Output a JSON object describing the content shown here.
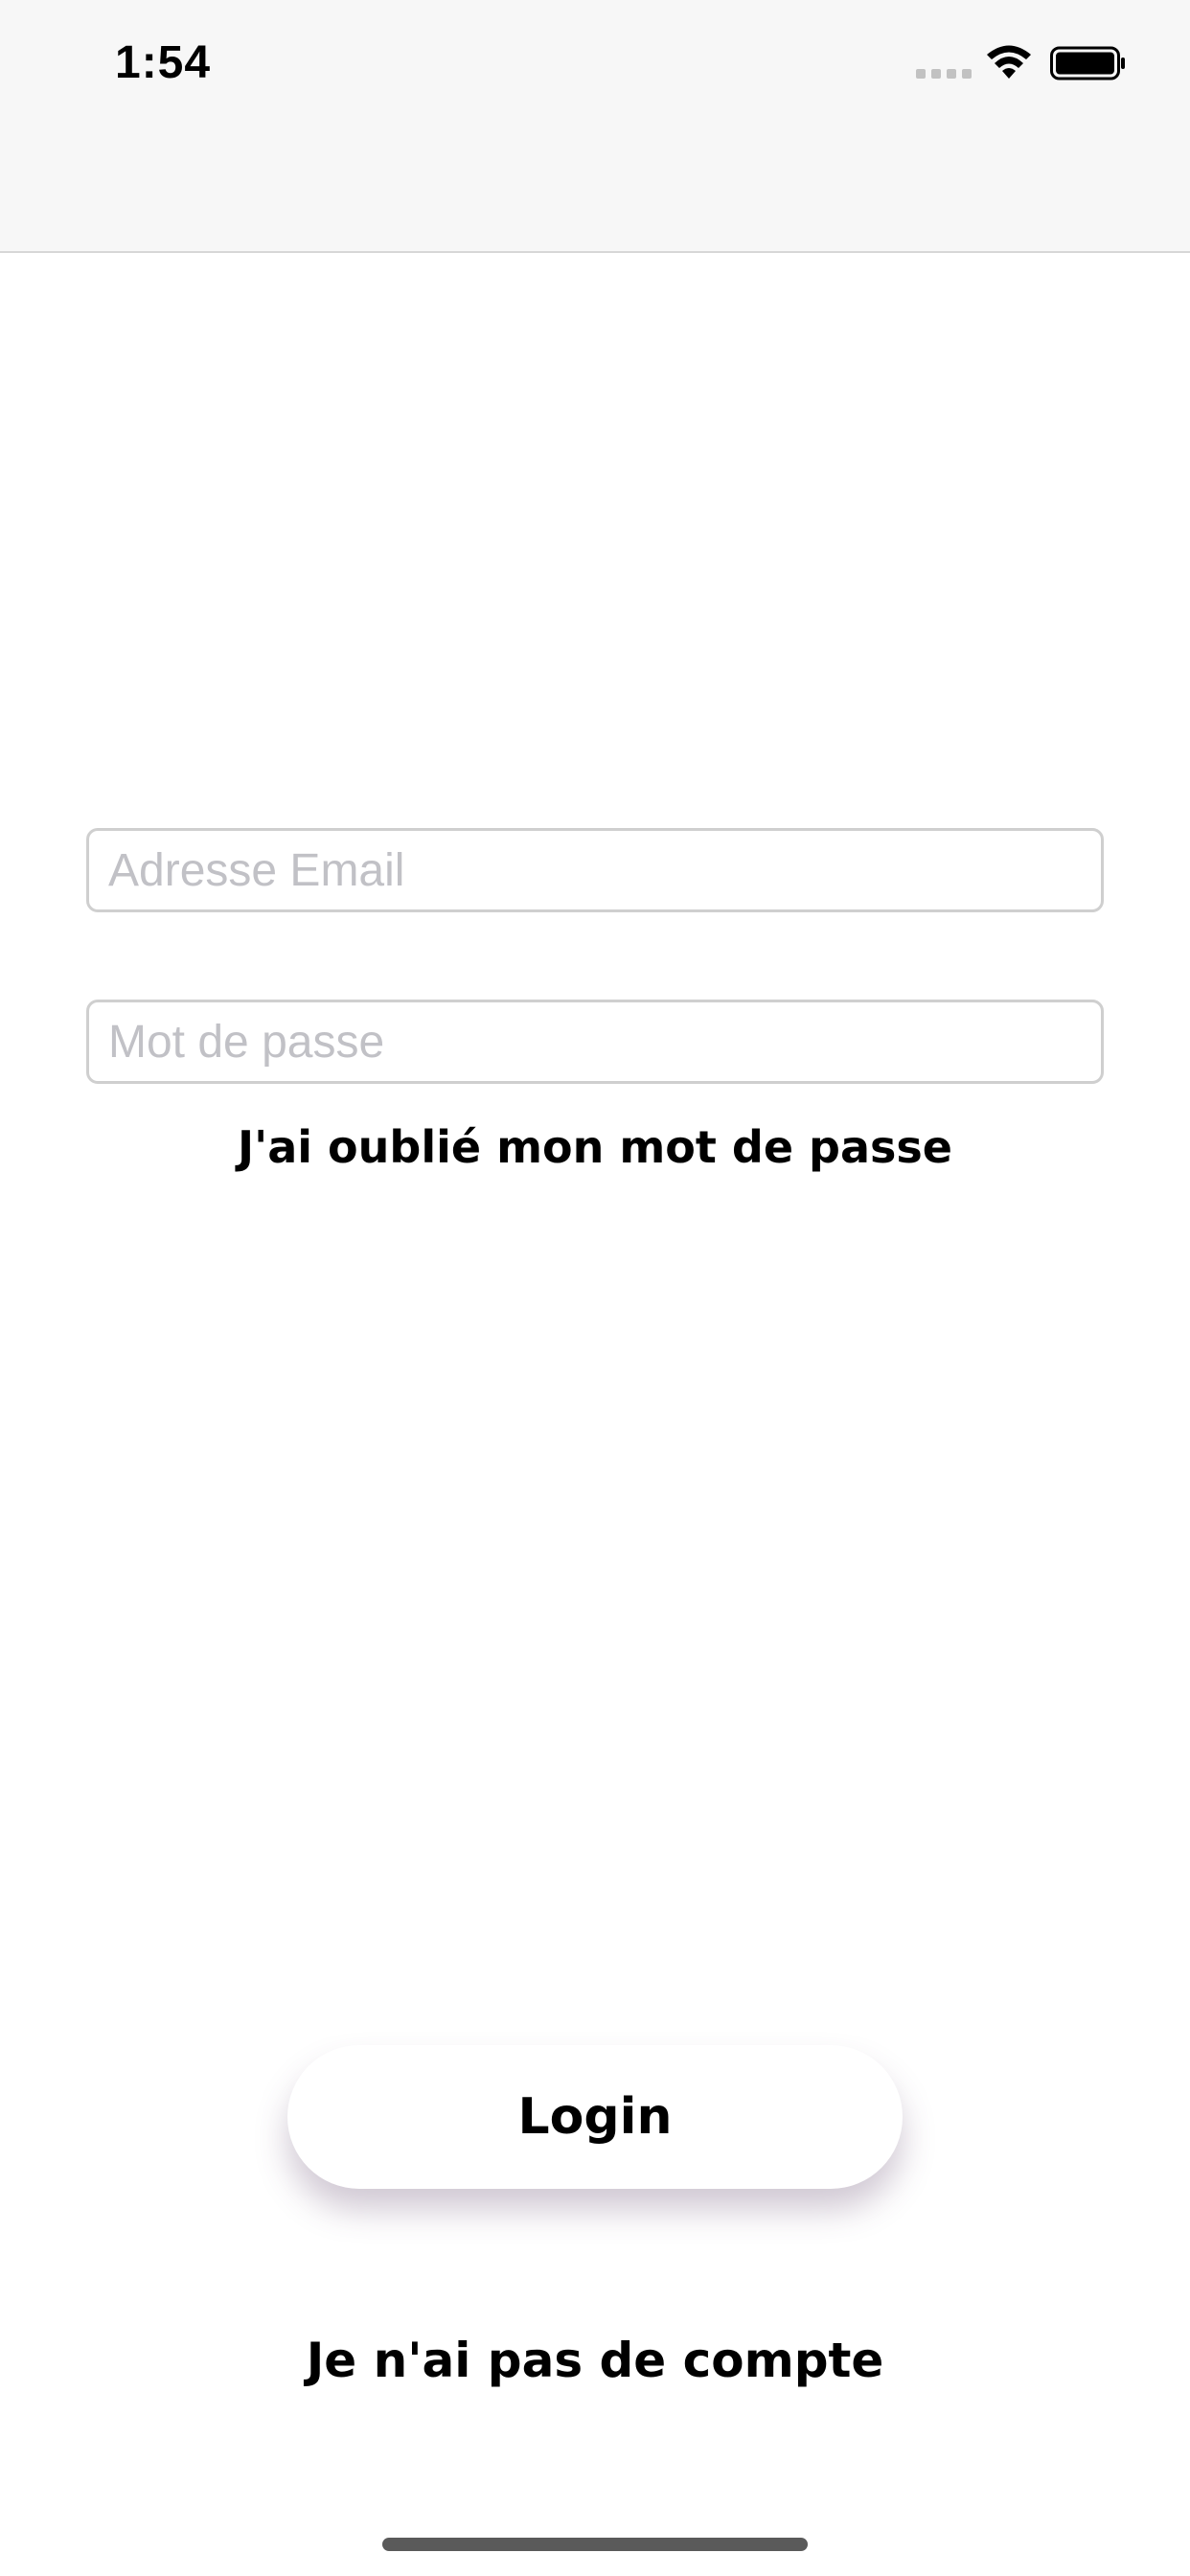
{
  "status_bar": {
    "time": "1:54",
    "icons": [
      "cellular-signal-icon",
      "wifi-icon",
      "battery-icon"
    ]
  },
  "login_form": {
    "email": {
      "placeholder": "Adresse Email",
      "value": ""
    },
    "password": {
      "placeholder": "Mot de passe",
      "value": ""
    },
    "forgot_password_label": "J'ai oublié mon mot de passe",
    "login_label": "Login",
    "no_account_label": "Je n'ai pas de compte"
  },
  "colors": {
    "background": "#ffffff",
    "nav_background": "#f7f7f7",
    "text": "#000000",
    "placeholder": "#c1c1c6",
    "field_border": "#cfcfcf"
  }
}
